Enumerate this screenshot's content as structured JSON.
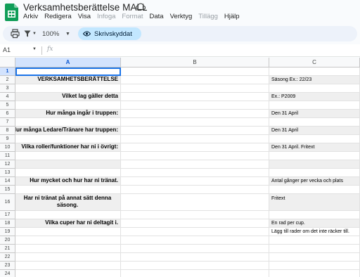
{
  "app": {
    "doc_title": "Verksamhetsberättelse MALL",
    "menu": [
      {
        "label": "Arkiv",
        "enabled": true
      },
      {
        "label": "Redigera",
        "enabled": true
      },
      {
        "label": "Visa",
        "enabled": true
      },
      {
        "label": "Infoga",
        "enabled": false
      },
      {
        "label": "Format",
        "enabled": false
      },
      {
        "label": "Data",
        "enabled": true
      },
      {
        "label": "Verktyg",
        "enabled": true
      },
      {
        "label": "Tillägg",
        "enabled": false
      },
      {
        "label": "Hjälp",
        "enabled": true
      }
    ]
  },
  "toolbar": {
    "zoom": "100%",
    "readonly_label": "Skrivskyddat"
  },
  "formula_bar": {
    "name_box": "A1",
    "fx": "fx",
    "value": ""
  },
  "grid": {
    "columns": [
      "A",
      "B",
      "C"
    ],
    "selected_column": "A",
    "selected_row": "1",
    "rows": [
      {
        "num": "1",
        "a": "",
        "c": "",
        "shaded": false
      },
      {
        "num": "2",
        "a": "VERKSAMHETSBERÄTTELSE",
        "c": "Säsong Ex.: 22/23",
        "shaded": true
      },
      {
        "num": "3",
        "a": "",
        "c": "",
        "shaded": false
      },
      {
        "num": "4",
        "a": "Vilket lag gäller detta",
        "c": "Ex.: P2009",
        "shaded": true
      },
      {
        "num": "5",
        "a": "",
        "c": "",
        "shaded": false
      },
      {
        "num": "6",
        "a": "Hur många ingår i truppen:",
        "c": "Den 31 April",
        "shaded": true
      },
      {
        "num": "7",
        "a": "",
        "c": "",
        "shaded": false
      },
      {
        "num": "8",
        "a": "Hur många Ledare/Tränare har truppen:",
        "c": "Den 31 April",
        "shaded": true
      },
      {
        "num": "9",
        "a": "",
        "c": "",
        "shaded": false
      },
      {
        "num": "10",
        "a": "Vilka roller/funktioner har ni i övrigt:",
        "c": "Den 31 April. Fritext",
        "shaded": true
      },
      {
        "num": "11",
        "a": "",
        "c": "",
        "shaded": false
      },
      {
        "num": "12",
        "a": "",
        "c": "",
        "shaded": true
      },
      {
        "num": "13",
        "a": "",
        "c": "",
        "shaded": false
      },
      {
        "num": "14",
        "a": "Hur mycket och hur har ni tränat.",
        "c": "Antal gånger per vecka och plats",
        "shaded": true
      },
      {
        "num": "15",
        "a": "",
        "c": "",
        "shaded": false
      },
      {
        "num": "16",
        "a": "Har ni tränat på annat sätt denna säsong.",
        "c": "Fritext",
        "shaded": true
      },
      {
        "num": "17",
        "a": "",
        "c": "",
        "shaded": false
      },
      {
        "num": "18",
        "a": "Vilka cuper har ni deltagit i.",
        "c": "En rad per cup.",
        "shaded": true
      },
      {
        "num": "19",
        "a": "",
        "c": "Lägg till rader om det inte räcker till.",
        "shaded": false
      },
      {
        "num": "20",
        "a": "",
        "c": "",
        "shaded": false
      },
      {
        "num": "21",
        "a": "",
        "c": "",
        "shaded": false
      },
      {
        "num": "22",
        "a": "",
        "c": "",
        "shaded": false
      },
      {
        "num": "23",
        "a": "",
        "c": "",
        "shaded": false
      },
      {
        "num": "24",
        "a": "",
        "c": "",
        "shaded": false
      }
    ]
  }
}
